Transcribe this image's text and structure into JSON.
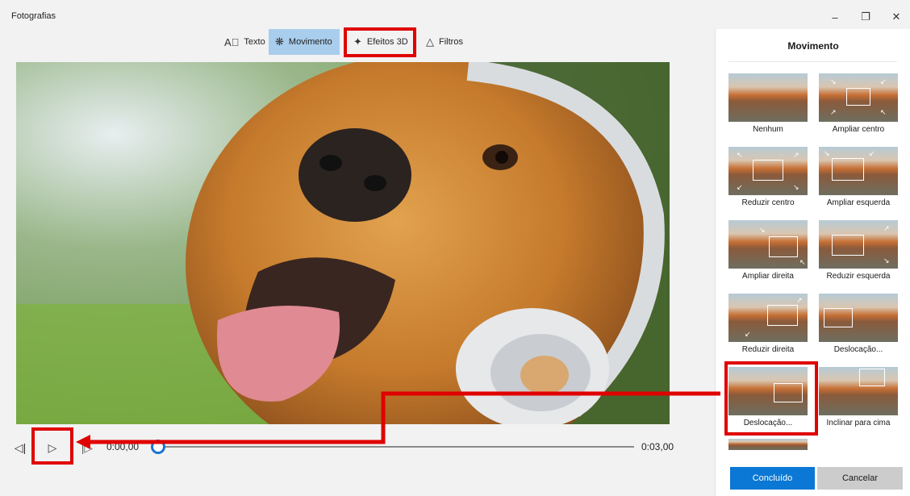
{
  "app": {
    "title": "Fotografias"
  },
  "window": {
    "minimize_icon": "minimize-icon",
    "restore_icon": "restore-icon",
    "close_icon": "close-icon"
  },
  "toolbar": {
    "items": [
      {
        "label": "Texto",
        "icon": "text-icon",
        "active": false
      },
      {
        "label": "Movimento",
        "icon": "motion-icon",
        "active": true
      },
      {
        "label": "Efeitos 3D",
        "icon": "effects-3d-icon",
        "active": false
      },
      {
        "label": "Filtros",
        "icon": "filters-icon",
        "active": false
      }
    ]
  },
  "player": {
    "current_time": "0:00,00",
    "total_time": "0:03,00",
    "progress": 0
  },
  "panel": {
    "title": "Movimento",
    "options": [
      {
        "label": "Nenhum"
      },
      {
        "label": "Ampliar centro"
      },
      {
        "label": "Reduzir centro"
      },
      {
        "label": "Ampliar esquerda"
      },
      {
        "label": "Ampliar direita"
      },
      {
        "label": "Reduzir esquerda"
      },
      {
        "label": "Reduzir direita"
      },
      {
        "label": "Deslocação..."
      },
      {
        "label": "Deslocação..."
      },
      {
        "label": "Inclinar para cima"
      }
    ],
    "confirm_label": "Concluído",
    "cancel_label": "Cancelar"
  },
  "colors": {
    "accent": "#0a78d4",
    "active_tab": "#a9cdec",
    "highlight": "#e00000"
  }
}
